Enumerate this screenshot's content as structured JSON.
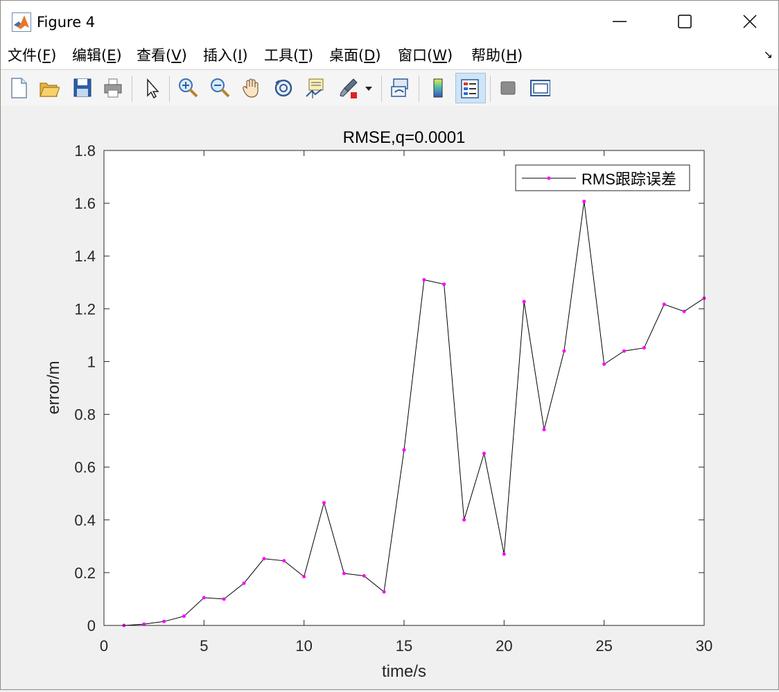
{
  "window": {
    "title": "Figure 4",
    "controls": [
      "minimize-icon",
      "maximize-icon",
      "close-icon"
    ]
  },
  "menubar": {
    "items": [
      {
        "label": "文件(",
        "key": "F",
        "end": ")"
      },
      {
        "label": "编辑(",
        "key": "E",
        "end": ")"
      },
      {
        "label": "查看(",
        "key": "V",
        "end": ")"
      },
      {
        "label": "插入(",
        "key": "I",
        "end": ")"
      },
      {
        "label": "工具(",
        "key": "T",
        "end": ")"
      },
      {
        "label": "桌面(",
        "key": "D",
        "end": ")"
      },
      {
        "label": "窗口(",
        "key": "W",
        "end": ")"
      },
      {
        "label": "帮助(",
        "key": "H",
        "end": ")"
      }
    ],
    "dock_arrow": "↘"
  },
  "toolbar": {
    "buttons": [
      "new-figure-icon",
      "open-file-icon",
      "save-icon",
      "print-icon",
      "select-pointer-icon",
      "zoom-in-icon",
      "zoom-out-icon",
      "pan-hand-icon",
      "rotate-3d-icon",
      "data-cursor-icon",
      "brush-icon",
      "link-plot-icon",
      "colorbar-icon",
      "legend-icon",
      "hide-plot-tools-icon",
      "show-plot-tools-icon"
    ],
    "active": "legend-icon"
  },
  "chart_data": {
    "type": "line",
    "title": "RMSE,q=0.0001",
    "xlabel": "time/s",
    "ylabel": "error/m",
    "xlim": [
      0,
      30
    ],
    "ylim": [
      0,
      1.8
    ],
    "xticks": [
      0,
      5,
      10,
      15,
      20,
      25,
      30
    ],
    "xtick_labels": [
      "0",
      "5",
      "10",
      "15",
      "20",
      "25",
      "30"
    ],
    "yticks": [
      0,
      0.2,
      0.4,
      0.6,
      0.8,
      1,
      1.2,
      1.4,
      1.6,
      1.8
    ],
    "ytick_labels": [
      "0",
      "0.2",
      "0.4",
      "0.6",
      "0.8",
      "1",
      "1.2",
      "1.4",
      "1.6",
      "1.8"
    ],
    "grid": false,
    "legend": "top-right",
    "line_color": "#000000",
    "marker_color": "#ff00ff",
    "series": [
      {
        "name": "RMS跟踪误差",
        "x": [
          1,
          2,
          3,
          4,
          5,
          6,
          7,
          8,
          9,
          10,
          11,
          12,
          13,
          14,
          15,
          16,
          17,
          18,
          19,
          20,
          21,
          22,
          23,
          24,
          25,
          26,
          27,
          28,
          29,
          30
        ],
        "y": [
          0.0,
          0.005,
          0.015,
          0.035,
          0.105,
          0.1,
          0.16,
          0.253,
          0.245,
          0.185,
          0.465,
          0.197,
          0.188,
          0.127,
          0.665,
          1.31,
          1.293,
          0.4,
          0.652,
          0.27,
          1.227,
          0.742,
          1.04,
          1.607,
          0.99,
          1.04,
          1.052,
          1.217,
          1.19,
          1.24
        ]
      }
    ]
  }
}
